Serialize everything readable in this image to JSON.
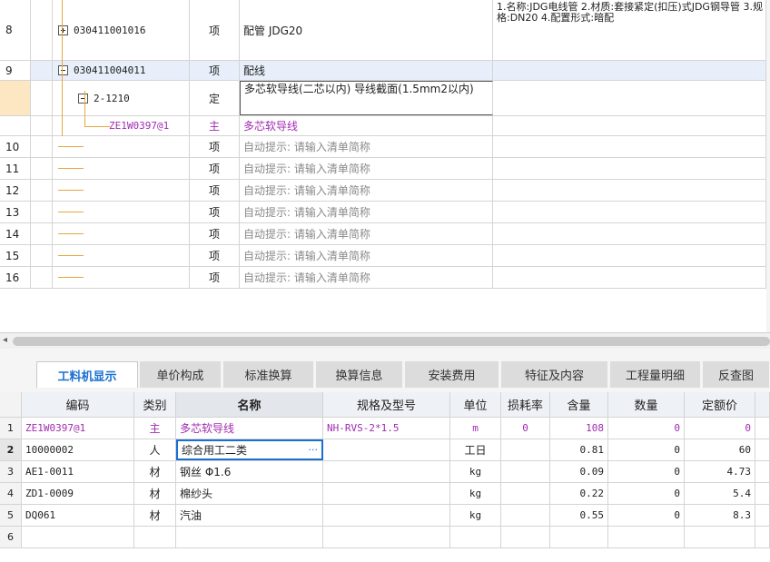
{
  "top_rows": [
    {
      "no": "8",
      "code": "030411001016",
      "type": "项",
      "name": "配管 JDG20",
      "desc": "1.名称:JDG电线管\n2.材质:套接紧定(扣压)式JDG钢导管\n3.规格:DN20\n4.配置形式:暗配"
    },
    {
      "no": "9",
      "code": "030411004011",
      "type": "项",
      "name": "配线",
      "desc": ""
    },
    {
      "no": "",
      "code": "2-1210",
      "type": "定",
      "name": "多芯软导线(二芯以内) 导线截面(1.5mm2以内)",
      "desc": ""
    },
    {
      "no": "",
      "code": "ZE1W0397@1",
      "type": "主",
      "name": "多芯软导线",
      "desc": ""
    },
    {
      "no": "10",
      "code": "",
      "type": "项",
      "name": "自动提示: 请输入清单简称",
      "desc": ""
    },
    {
      "no": "11",
      "code": "",
      "type": "项",
      "name": "自动提示: 请输入清单简称",
      "desc": ""
    },
    {
      "no": "12",
      "code": "",
      "type": "项",
      "name": "自动提示: 请输入清单简称",
      "desc": ""
    },
    {
      "no": "13",
      "code": "",
      "type": "项",
      "name": "自动提示: 请输入清单简称",
      "desc": ""
    },
    {
      "no": "14",
      "code": "",
      "type": "项",
      "name": "自动提示: 请输入清单简称",
      "desc": ""
    },
    {
      "no": "15",
      "code": "",
      "type": "项",
      "name": "自动提示: 请输入清单简称",
      "desc": ""
    },
    {
      "no": "16",
      "code": "",
      "type": "项",
      "name": "自动提示: 请输入清单简称",
      "desc": ""
    }
  ],
  "tabs": [
    "工料机显示",
    "单价构成",
    "标准换算",
    "换算信息",
    "安装费用",
    "特征及内容",
    "工程量明细",
    "反查图"
  ],
  "bottom_headers": {
    "code": "编码",
    "type": "类别",
    "name": "名称",
    "spec": "规格及型号",
    "unit": "单位",
    "loss": "损耗率",
    "qty": "含量",
    "count": "数量",
    "price": "定额价"
  },
  "bottom_rows": [
    {
      "no": "1",
      "code": "ZE1W0397@1",
      "type": "主",
      "name": "多芯软导线",
      "spec": "NH-RVS-2*1.5",
      "unit": "m",
      "loss": "0",
      "qty": "108",
      "count": "0",
      "price": "0"
    },
    {
      "no": "2",
      "code": "10000002",
      "type": "人",
      "name": "综合用工二类",
      "spec": "",
      "unit": "工日",
      "loss": "",
      "qty": "0.81",
      "count": "0",
      "price": "60"
    },
    {
      "no": "3",
      "code": "AE1-0011",
      "type": "材",
      "name": "钢丝 Φ1.6",
      "spec": "",
      "unit": "kg",
      "loss": "",
      "qty": "0.09",
      "count": "0",
      "price": "4.73"
    },
    {
      "no": "4",
      "code": "ZD1-0009",
      "type": "材",
      "name": "棉纱头",
      "spec": "",
      "unit": "kg",
      "loss": "",
      "qty": "0.22",
      "count": "0",
      "price": "5.4"
    },
    {
      "no": "5",
      "code": "DQ061",
      "type": "材",
      "name": "汽油",
      "spec": "",
      "unit": "kg",
      "loss": "",
      "qty": "0.55",
      "count": "0",
      "price": "8.3"
    },
    {
      "no": "6",
      "code": "",
      "type": "",
      "name": "",
      "spec": "",
      "unit": "",
      "loss": "",
      "qty": "",
      "count": "",
      "price": ""
    }
  ],
  "colors": {
    "active_tab": "#1a6fd1",
    "main_material": "#a12bb2",
    "tree_line": "#e8a640",
    "row_highlight": "#e8effa"
  },
  "icons": {
    "expanded": "minus-box-icon",
    "collapsed": "plus-box-icon",
    "more": "ellipsis-icon"
  }
}
